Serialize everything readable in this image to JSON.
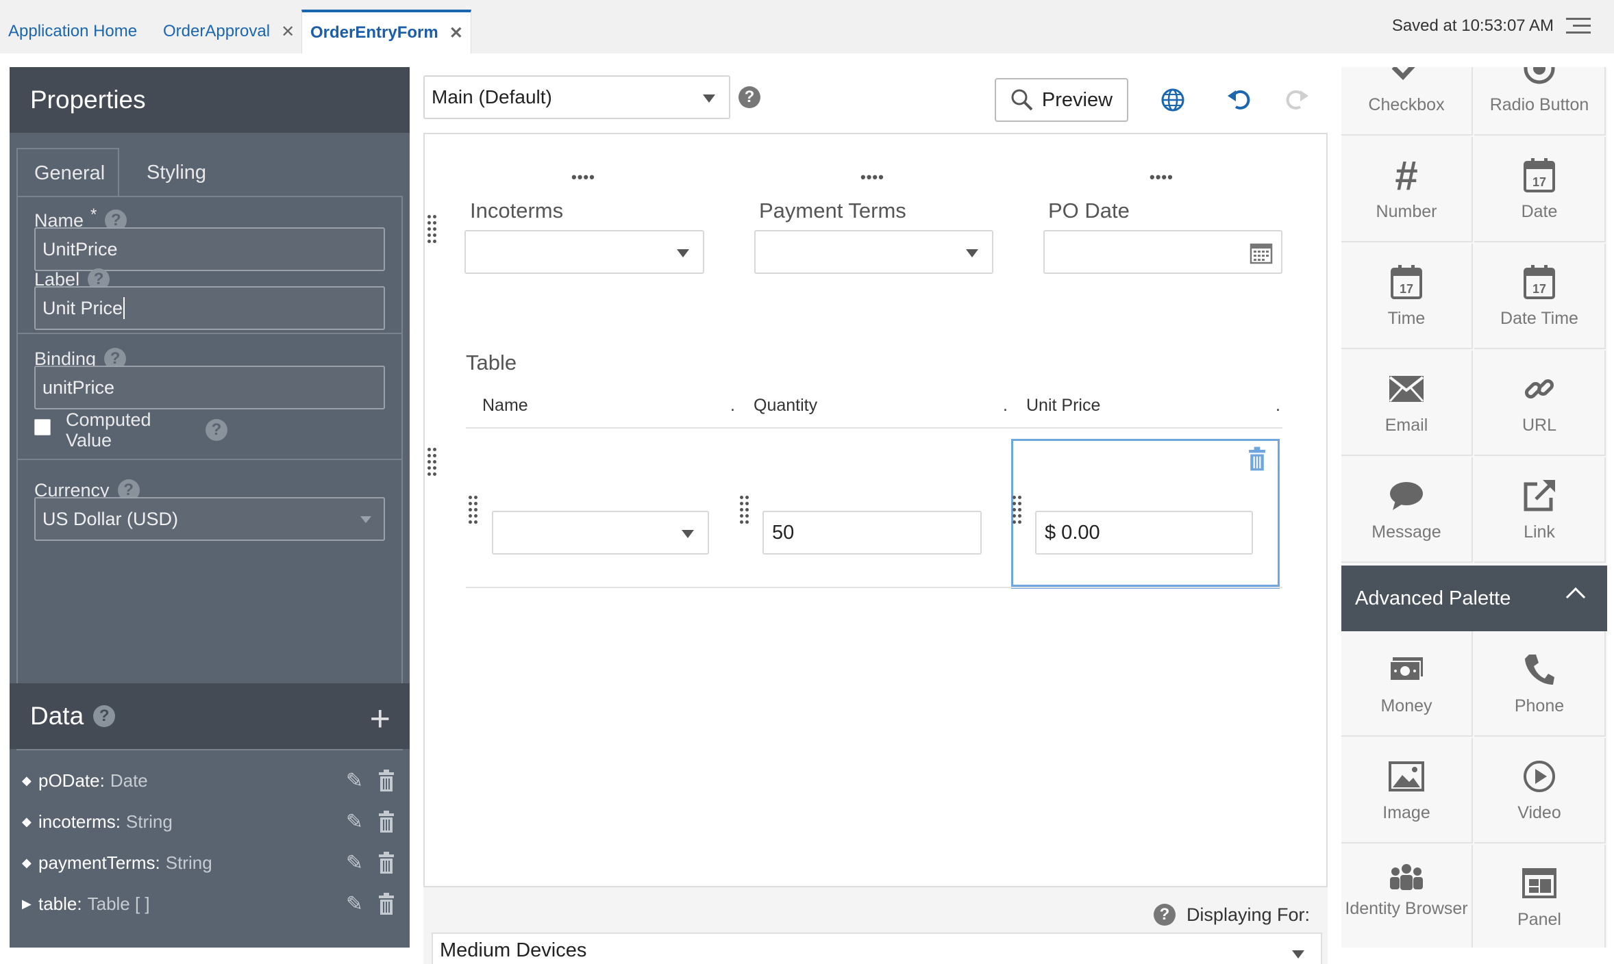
{
  "tabs": [
    {
      "label": "Application Home"
    },
    {
      "label": "OrderApproval"
    },
    {
      "label": "OrderEntryForm"
    }
  ],
  "saved_status": "Saved at 10:53:07 AM",
  "properties": {
    "title": "Properties",
    "tabs": [
      "General",
      "Styling"
    ],
    "name_label": "Name",
    "required_mark": "*",
    "name_value": "UnitPrice",
    "label_label": "Label",
    "label_value": "Unit Price",
    "binding_label": "Binding",
    "binding_value": "unitPrice",
    "computed_label_1": "Computed",
    "computed_label_2": "Value",
    "currency_label": "Currency",
    "currency_value": "US Dollar (USD)",
    "help_glyph": "?"
  },
  "data_panel": {
    "title": "Data",
    "add_glyph": "+",
    "items": [
      {
        "name": "pODate:",
        "type": "Date",
        "bullet": "◆"
      },
      {
        "name": "incoterms:",
        "type": "String",
        "bullet": "◆"
      },
      {
        "name": "paymentTerms:",
        "type": "String",
        "bullet": "◆"
      },
      {
        "name": "table:",
        "type": "Table [ ]",
        "bullet": "▶"
      }
    ]
  },
  "toolbar": {
    "layout_value": "Main (Default)",
    "help_glyph": "?",
    "preview_label": "Preview"
  },
  "form": {
    "field_grip": "••••",
    "incoterms_label": "Incoterms",
    "payment_terms_label": "Payment Terms",
    "po_date_label": "PO Date",
    "table_title": "Table",
    "columns": [
      "Name",
      "Quantity",
      "Unit Price"
    ],
    "column_sep": ".",
    "quantity_value": "50",
    "unit_price_value": "$ 0.00"
  },
  "footer": {
    "help_glyph": "?",
    "displaying_for_label": "Displaying For:",
    "device_value": "Medium Devices"
  },
  "palette": {
    "basic": [
      {
        "label": "Checkbox",
        "icon": "checkmark-icon"
      },
      {
        "label": "Radio Button",
        "icon": "radio-icon"
      },
      {
        "label": "Number",
        "icon": "hash-icon"
      },
      {
        "label": "Date",
        "icon": "calendar-icon"
      },
      {
        "label": "Time",
        "icon": "calendar-icon"
      },
      {
        "label": "Date Time",
        "icon": "calendar-icon"
      },
      {
        "label": "Email",
        "icon": "envelope-icon"
      },
      {
        "label": "URL",
        "icon": "link-icon"
      },
      {
        "label": "Message",
        "icon": "speech-bubble-icon"
      },
      {
        "label": "Link",
        "icon": "external-link-icon"
      }
    ],
    "calendar_day": "17",
    "number_glyph": "#",
    "advanced_title": "Advanced Palette",
    "advanced": [
      {
        "label": "Money",
        "icon": "money-icon"
      },
      {
        "label": "Phone",
        "icon": "phone-icon"
      },
      {
        "label": "Image",
        "icon": "image-icon"
      },
      {
        "label": "Video",
        "icon": "video-icon"
      },
      {
        "label": "Identity Browser",
        "icon": "people-icon"
      },
      {
        "label": "Panel",
        "icon": "panel-icon"
      }
    ]
  },
  "colors": {
    "accent": "#1a66b0",
    "panel_bg": "#5a6370",
    "panel_header": "#444b55",
    "selection": "#6fa6de"
  }
}
